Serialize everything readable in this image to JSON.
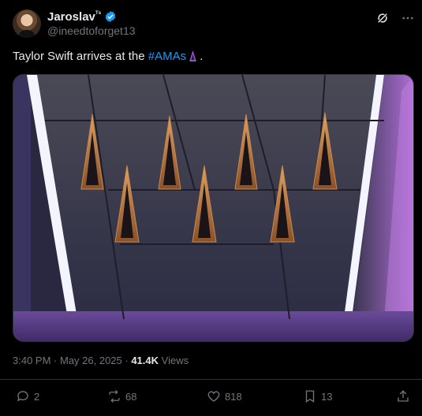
{
  "author": {
    "display_name": "Jaroslav",
    "name_suffix": "ᵀˢ",
    "handle": "@ineedtoforget13",
    "verified": true,
    "verified_color": "#1d9bf0"
  },
  "header_icons": [
    "grok-icon",
    "more-icon"
  ],
  "tweet": {
    "text_before": "Taylor Swift arrives at the ",
    "hashtag": "#AMAs",
    "text_after": " ."
  },
  "media": {
    "alt": "photo",
    "description_colors": {
      "wall": "#3a3a4a",
      "floor": "#5a3f85",
      "neon": "#b76bff",
      "niche": "#c98a4a"
    }
  },
  "meta": {
    "time": "3:40 PM",
    "separator1": " · ",
    "date": "May 26, 2025",
    "separator2": " · ",
    "views_count": "41.4K",
    "views_label": " Views"
  },
  "actions": {
    "replies": "2",
    "reposts": "68",
    "likes": "818",
    "bookmarks": "13"
  }
}
